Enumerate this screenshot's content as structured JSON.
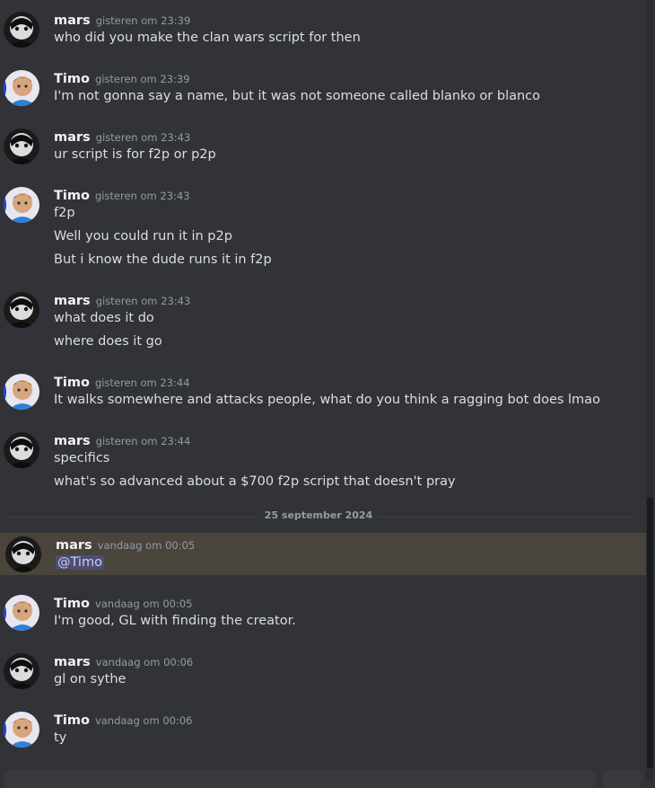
{
  "users": {
    "mars": {
      "name": "mars",
      "avatar_icon": "mars-avatar-icon"
    },
    "timo": {
      "name": "Timo",
      "avatar_icon": "timo-avatar-icon"
    }
  },
  "messages": [
    {
      "author": "mars",
      "timestamp": "gisteren om 23:39",
      "lines": [
        "who did you make the clan wars script for then"
      ]
    },
    {
      "author": "Timo",
      "timestamp": "gisteren om 23:39",
      "lines": [
        "I'm not gonna say a name, but it was not someone called blanko or blanco"
      ]
    },
    {
      "author": "mars",
      "timestamp": "gisteren om 23:43",
      "lines": [
        "ur script is for f2p or p2p"
      ]
    },
    {
      "author": "Timo",
      "timestamp": "gisteren om 23:43",
      "lines": [
        "f2p",
        "Well you could run it in p2p",
        "But i know the dude runs it in f2p"
      ]
    },
    {
      "author": "mars",
      "timestamp": "gisteren om 23:43",
      "lines": [
        "what does it do",
        "where does it go"
      ]
    },
    {
      "author": "Timo",
      "timestamp": "gisteren om 23:44",
      "lines": [
        "It walks somewhere and attacks people, what do you think a ragging bot does lmao"
      ]
    },
    {
      "author": "mars",
      "timestamp": "gisteren om 23:44",
      "lines": [
        "specifics",
        "what's so advanced about a $700 f2p script that doesn't pray"
      ]
    },
    {
      "author": "mars",
      "timestamp": "vandaag om 00:05",
      "lines": [
        "@Timo"
      ],
      "highlighted": true
    },
    {
      "author": "Timo",
      "timestamp": "vandaag om 00:05",
      "lines": [
        "I'm good, GL with finding the creator."
      ]
    },
    {
      "author": "mars",
      "timestamp": "vandaag om 00:06",
      "lines": [
        "gl on sythe"
      ]
    },
    {
      "author": "Timo",
      "timestamp": "vandaag om 00:06",
      "lines": [
        "ty"
      ]
    }
  ],
  "date_divider": "25 september 2024",
  "colors": {
    "background": "#313338",
    "text": "#dbdee1",
    "author": "#f2f3f5",
    "timestamp": "#949ba4",
    "highlight": "#49443c",
    "mention": "#c9cdfb"
  }
}
